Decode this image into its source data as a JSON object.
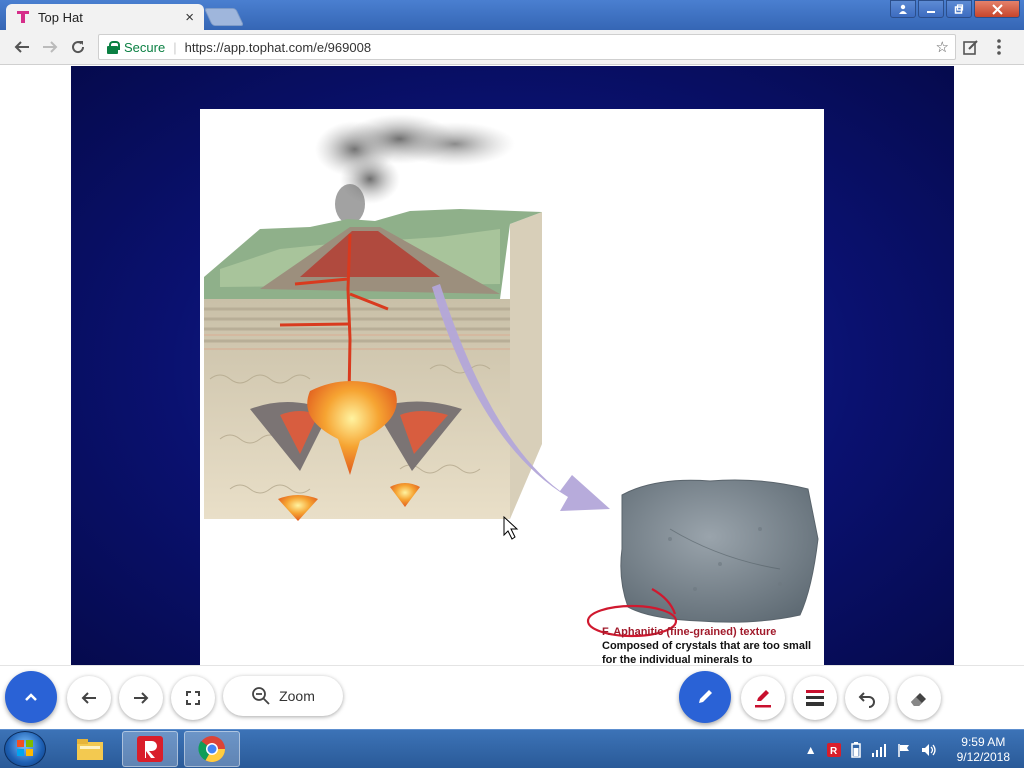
{
  "browser": {
    "tab_title": "Top Hat",
    "tab_close": "×",
    "secure_label": "Secure",
    "url": "https://app.tophat.com/e/969008",
    "back_icon": "arrow-left-icon",
    "forward_icon": "arrow-right-icon",
    "reload_icon": "reload-icon"
  },
  "slide": {
    "caption_title": "F. Aphanitic (fine-grained) texture",
    "caption_body": "Composed of crystals that are too small for the individual minerals to"
  },
  "controls": {
    "zoom_label": "Zoom",
    "colors": {
      "primary": "#2a62d6",
      "pen_red": "#c8102e"
    }
  },
  "taskbar": {
    "time": "9:59 AM",
    "date": "9/12/2018"
  }
}
